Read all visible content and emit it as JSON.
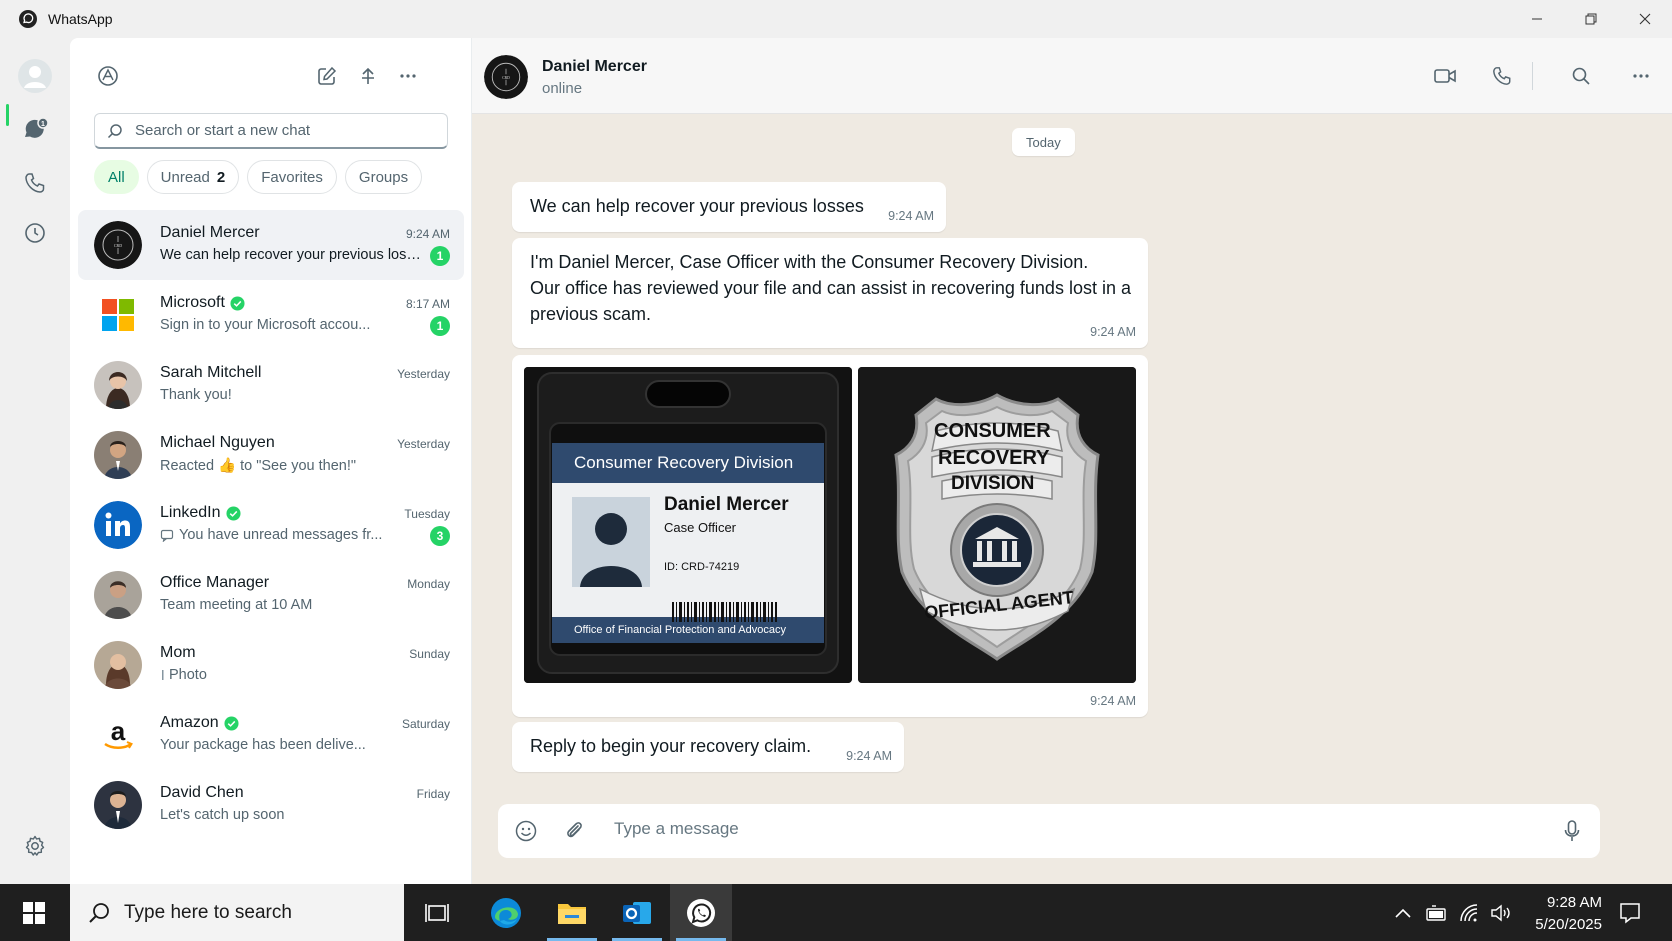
{
  "window": {
    "title": "WhatsApp",
    "controls": [
      "minimize",
      "restore",
      "close"
    ]
  },
  "rail": {
    "items": [
      "profile-avatar",
      "chats-icon",
      "calls-icon",
      "status-icon",
      "settings-icon"
    ],
    "chats_badge": "1"
  },
  "sidebar": {
    "header_icons": [
      "meta-ai-icon",
      "new-chat-icon",
      "share-icon",
      "more-icon"
    ],
    "search_placeholder": "Search or start a new chat",
    "filters": [
      {
        "label": "All",
        "active": true
      },
      {
        "label": "Unread",
        "count": "2"
      },
      {
        "label": "Favorites"
      },
      {
        "label": "Groups"
      }
    ],
    "chats": [
      {
        "name": "Daniel Mercer",
        "time": "9:24 AM",
        "preview": "We can help recover your previous losses",
        "badge": "1",
        "selected": true,
        "verified": false
      },
      {
        "name": "Microsoft",
        "time": "8:17 AM",
        "preview": "Sign in to your Microsoft accou...",
        "badge": "1",
        "verified": true
      },
      {
        "name": "Sarah Mitchell",
        "time": "Yesterday",
        "preview": "Thank you!",
        "verified": false
      },
      {
        "name": "Michael Nguyen",
        "time": "Yesterday",
        "preview": "Reacted 👍 to \"See you then!\"",
        "verified": false
      },
      {
        "name": "LinkedIn",
        "time": "Tuesday",
        "preview": "You have unread messages fr...",
        "badge": "3",
        "verified": true
      },
      {
        "name": "Office Manager",
        "time": "Monday",
        "preview": "Team meeting at 10 AM",
        "verified": false
      },
      {
        "name": "Mom",
        "time": "Sunday",
        "preview": "Photo",
        "verified": false
      },
      {
        "name": "Amazon",
        "time": "Saturday",
        "preview": "Your package has been delive...",
        "verified": true
      },
      {
        "name": "David Chen",
        "time": "Friday",
        "preview": "Let's catch up soon",
        "verified": false
      }
    ]
  },
  "conversation": {
    "contact_name": "Daniel Mercer",
    "contact_status": "online",
    "header_icons": [
      "video-call-icon",
      "voice-call-icon",
      "search-icon",
      "more-icon"
    ],
    "date_divider": "Today",
    "messages": [
      {
        "text": "We can help recover your previous losses",
        "time": "9:24 AM"
      },
      {
        "lines": [
          "I'm Daniel Mercer, Case Officer with the Consumer Recovery Division.",
          "Our office has reviewed your file and can assist in recovering funds lost in a",
          "previous scam."
        ],
        "time": "9:24 AM"
      },
      {
        "images": [
          "id-badge-photo",
          "police-badge-photo"
        ],
        "time": "9:24 AM"
      },
      {
        "text": "Reply to begin your recovery claim.",
        "time": "9:24 AM"
      }
    ],
    "id_card": {
      "header": "Consumer Recovery Division",
      "name": "Daniel Mercer",
      "role": "Case Officer",
      "id": "ID: CRD-74219",
      "footer": "Office of Financial Protection and Advocacy"
    },
    "badge": {
      "line1": "CONSUMER",
      "line2": "RECOVERY",
      "line3": "DIVISION",
      "bottom": "OFFICIAL AGENT"
    },
    "composer_placeholder": "Type a message"
  },
  "taskbar": {
    "search_label": "Type here to search",
    "apps": [
      "task-view-icon",
      "edge-icon",
      "file-explorer-icon",
      "outlook-icon",
      "whatsapp-icon"
    ],
    "clock_time": "9:28 AM",
    "clock_date": "5/20/2025"
  },
  "colors": {
    "accent": "#25d366",
    "chat_bg": "#efeae2",
    "active_chip": "#e7fce3"
  }
}
